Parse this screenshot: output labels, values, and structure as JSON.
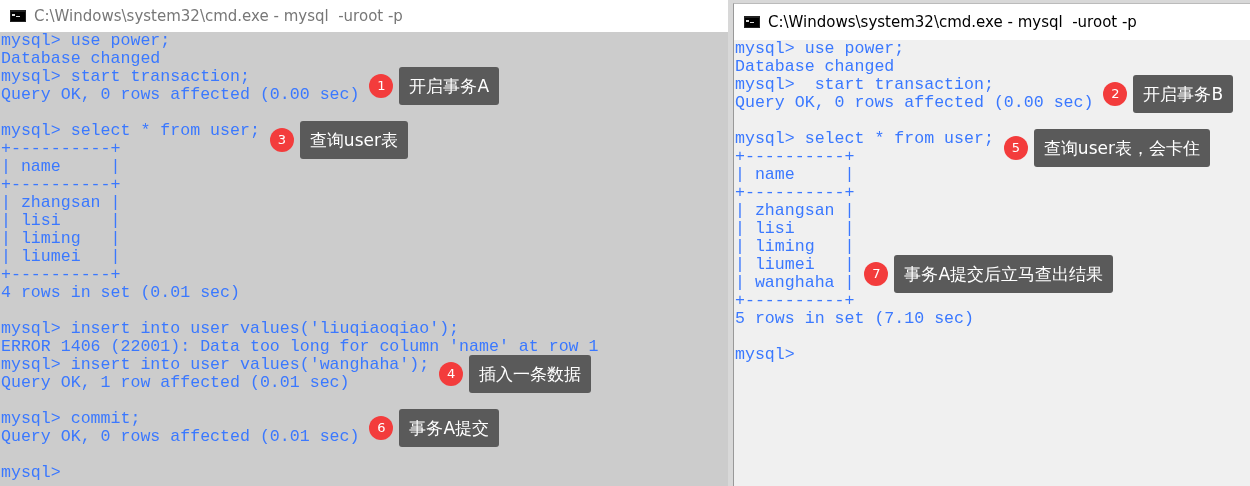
{
  "windows": [
    {
      "title": "C:\\Windows\\system32\\cmd.exe - mysql  -uroot -p",
      "focused": false,
      "lines": [
        {
          "text": "mysql> use power;"
        },
        {
          "text": "Database changed"
        },
        {
          "text": "mysql> start transaction;",
          "callout": {
            "number": "1",
            "text": "开启事务A"
          }
        },
        {
          "text": "Query OK, 0 rows affected (0.00 sec)"
        },
        {
          "text": "mysql> select * from user;",
          "blank_before": true,
          "callout": {
            "number": "3",
            "text": "查询user表"
          }
        },
        {
          "text": "+----------+"
        },
        {
          "text": "| name     |"
        },
        {
          "text": "+----------+"
        },
        {
          "text": "| zhangsan |"
        },
        {
          "text": "| lisi     |"
        },
        {
          "text": "| liming   |"
        },
        {
          "text": "| liumei   |"
        },
        {
          "text": "+----------+"
        },
        {
          "text": "4 rows in set (0.01 sec)"
        },
        {
          "text": "mysql> insert into user values('liuqiaoqiao');",
          "blank_before": true
        },
        {
          "text": "ERROR 1406 (22001): Data too long for column 'name' at row 1"
        },
        {
          "text": "mysql> insert into user values('wanghaha');",
          "callout": {
            "number": "4",
            "text": "插入一条数据"
          }
        },
        {
          "text": "Query OK, 1 row affected (0.01 sec)"
        },
        {
          "text": "mysql> commit;",
          "blank_before": true,
          "callout": {
            "number": "6",
            "text": "事务A提交"
          }
        },
        {
          "text": "Query OK, 0 rows affected (0.01 sec)"
        },
        {
          "text": "mysql>",
          "blank_before": true
        }
      ]
    },
    {
      "title": "C:\\Windows\\system32\\cmd.exe - mysql  -uroot -p",
      "focused": true,
      "lines": [
        {
          "text": "mysql> use power;"
        },
        {
          "text": "Database changed"
        },
        {
          "text": "mysql>  start transaction;",
          "callout": {
            "number": "2",
            "text": "开启事务B"
          }
        },
        {
          "text": "Query OK, 0 rows affected (0.00 sec)"
        },
        {
          "text": "mysql> select * from user;",
          "blank_before": true,
          "callout": {
            "number": "5",
            "text": "查询user表，会卡住"
          }
        },
        {
          "text": "+----------+"
        },
        {
          "text": "| name     |"
        },
        {
          "text": "+----------+"
        },
        {
          "text": "| zhangsan |"
        },
        {
          "text": "| lisi     |"
        },
        {
          "text": "| liming   |"
        },
        {
          "text": "| liumei   |",
          "callout": {
            "number": "7",
            "text": "事务A提交后立马查出结果"
          }
        },
        {
          "text": "| wanghaha |"
        },
        {
          "text": "+----------+"
        },
        {
          "text": "5 rows in set (7.10 sec)"
        },
        {
          "text": "mysql>",
          "blank_before": true
        }
      ]
    }
  ]
}
